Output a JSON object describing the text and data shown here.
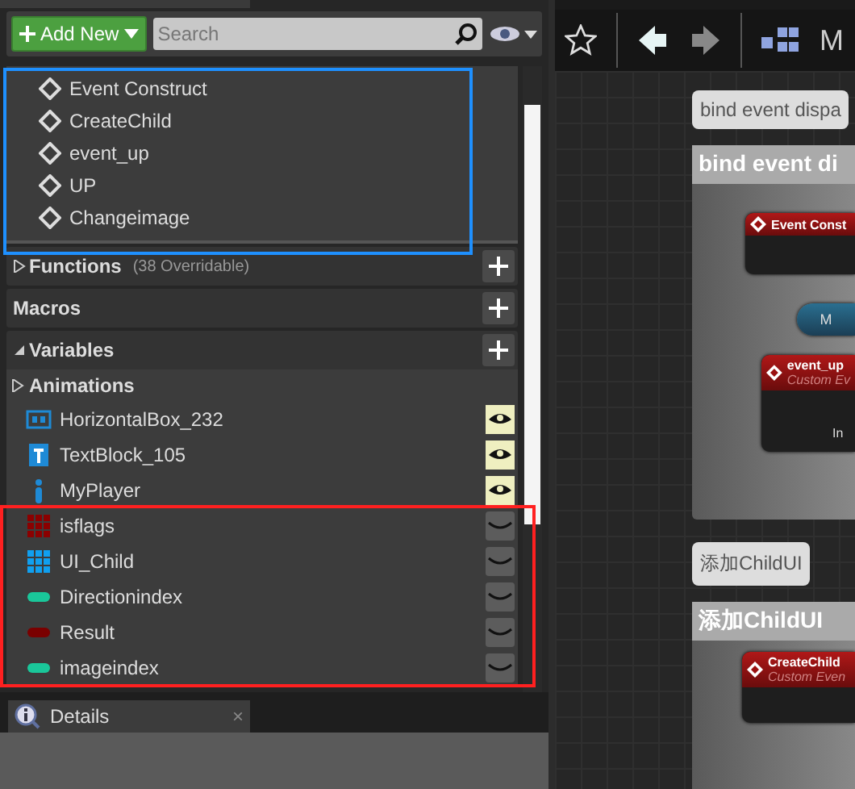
{
  "toolbar": {
    "add_button": "Add New",
    "search": {
      "placeholder": "Search"
    }
  },
  "event_graph": {
    "items": [
      "Event Construct",
      "CreateChild",
      "event_up",
      "UP",
      "Changeimage"
    ]
  },
  "sections": [
    {
      "kind": "header",
      "label": "Functions",
      "note": "(38 Overridable)",
      "expanded": false,
      "arrow": true
    },
    {
      "kind": "header",
      "label": "Macros",
      "expanded": false,
      "arrow": false
    },
    {
      "kind": "header",
      "label": "Variables",
      "expanded": true,
      "arrow": true
    }
  ],
  "categories": [
    {
      "label": "Animations",
      "expanded": false
    }
  ],
  "variables": [
    {
      "name": "HorizontalBox_232",
      "kind": "hbox",
      "color": "#1e8ad6",
      "visible": true
    },
    {
      "name": "TextBlock_105",
      "kind": "text",
      "color": "#1e8ad6",
      "visible": true
    },
    {
      "name": "MyPlayer",
      "kind": "actor",
      "color": "#1e8ad6",
      "visible": true
    },
    {
      "name": "isflags",
      "kind": "grid",
      "color": "#8b0000",
      "visible": false
    },
    {
      "name": "UI_Child",
      "kind": "grid",
      "color": "#10a0f0",
      "visible": false
    },
    {
      "name": "Directionindex",
      "kind": "pill",
      "color": "#1ac79a",
      "visible": false
    },
    {
      "name": "Result",
      "kind": "pill",
      "color": "#7a0000",
      "visible": false
    },
    {
      "name": "imageindex",
      "kind": "pill",
      "color": "#1ac79a",
      "visible": false
    }
  ],
  "highlights": [
    {
      "color": "#1e90ff"
    },
    {
      "color": "#ff2020"
    }
  ],
  "details_tab": {
    "label": "Details",
    "close": "×"
  },
  "graph": {
    "toolbar_label": "M",
    "comments": [
      {
        "bubble": "bind event dispa",
        "title": "bind event di"
      },
      {
        "bubble": "添加ChildUI",
        "title": "添加ChildUI"
      }
    ],
    "nodes": [
      {
        "kind": "event",
        "title": "Event Const"
      },
      {
        "kind": "pill",
        "title": "M"
      },
      {
        "kind": "custom",
        "title": "event_up",
        "subtitle": "Custom Ev",
        "pin": "In"
      },
      {
        "kind": "custom",
        "title": "CreateChild",
        "subtitle": "Custom Even"
      }
    ]
  }
}
